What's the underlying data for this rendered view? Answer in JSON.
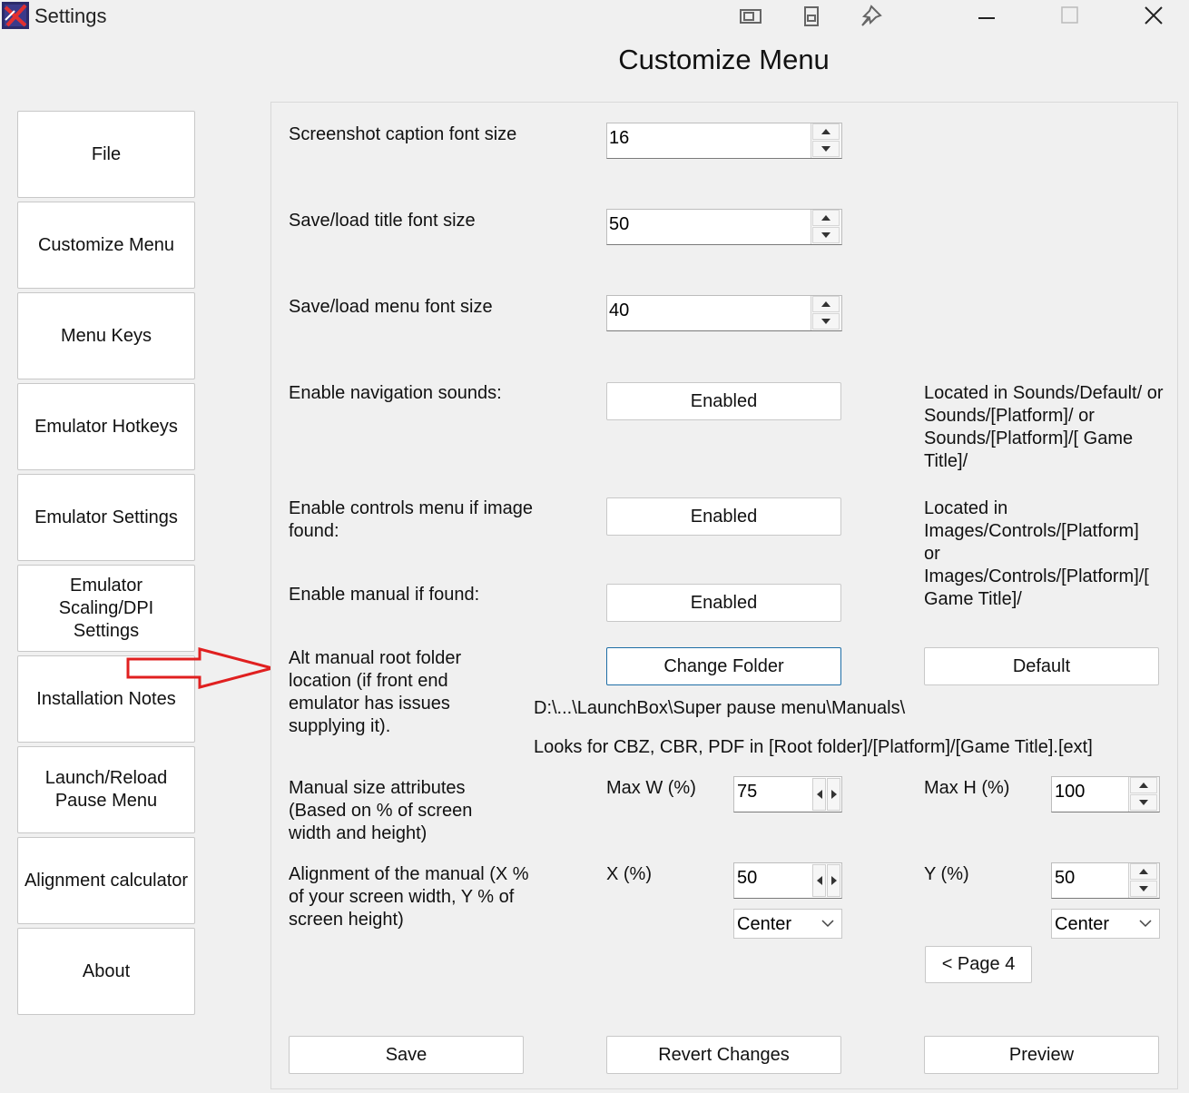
{
  "window": {
    "title": "Settings"
  },
  "page_title": "Customize Menu",
  "sidebar": {
    "items": [
      {
        "label": "File"
      },
      {
        "label": "Customize Menu"
      },
      {
        "label": "Menu Keys"
      },
      {
        "label": "Emulator Hotkeys"
      },
      {
        "label": "Emulator Settings"
      },
      {
        "label": "Emulator\nScaling/DPI\nSettings"
      },
      {
        "label": "Installation Notes"
      },
      {
        "label": "Launch/Reload\nPause Menu"
      },
      {
        "label": "Alignment calculator"
      },
      {
        "label": "About"
      }
    ]
  },
  "settings": {
    "caption_font": {
      "label": "Screenshot caption font size",
      "value": "16"
    },
    "title_font": {
      "label": "Save/load title font size",
      "value": "50"
    },
    "menu_font": {
      "label": "Save/load menu font size",
      "value": "40"
    },
    "nav_sounds": {
      "label": "Enable navigation sounds:",
      "button": "Enabled",
      "note": "Located in Sounds/Default/ or Sounds/[Platform]/ or Sounds/[Platform]/[ Game Title]/"
    },
    "controls_menu": {
      "label": "Enable controls menu if image found:",
      "button": "Enabled",
      "note": "Located in Images/Controls/[Platform]\n or\nImages/Controls/[Platform]/[ Game Title]/"
    },
    "manual": {
      "label": "Enable manual if found:",
      "button": "Enabled"
    },
    "alt_manual": {
      "label": "Alt manual root folder location (if front end emulator has issues supplying it).",
      "change_button": "Change Folder",
      "default_button": "Default",
      "path": "D:\\...\\LaunchBox\\Super pause menu\\Manuals\\",
      "hint": "Looks for CBZ, CBR, PDF in [Root folder]/[Platform]/[Game Title].[ext]"
    },
    "manual_size": {
      "label": "Manual size attributes (Based on % of screen width and height)",
      "max_w_label": "Max W (%)",
      "max_w": "75",
      "max_h_label": "Max H (%)",
      "max_h": "100"
    },
    "alignment": {
      "label": "Alignment of the manual (X % of your screen width, Y % of screen height)",
      "x_label": "X (%)",
      "x": "50",
      "x_align": "Center",
      "y_label": "Y (%)",
      "y": "50",
      "y_align": "Center"
    },
    "page_button": "< Page 4"
  },
  "footer": {
    "save": "Save",
    "revert": "Revert Changes",
    "preview": "Preview"
  },
  "colors": {
    "arrow": "#e02020",
    "focus_border": "#1e6ea6",
    "background": "#f0f0f0"
  }
}
